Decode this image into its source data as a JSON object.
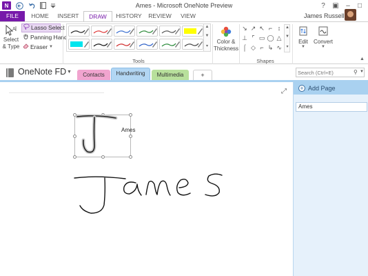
{
  "window": {
    "title": "Ames - Microsoft OneNote Preview",
    "app_icon_letter": "N",
    "qat_icons": [
      "back-icon",
      "undo-icon",
      "dock-to-desktop-icon",
      "customize-qat-icon"
    ],
    "controls": {
      "help": "?",
      "restore_ribbon": "▣",
      "minimize": "–",
      "maximize": "□"
    }
  },
  "ribbon_tabs": {
    "file": "FILE",
    "home": "HOME",
    "insert": "INSERT",
    "draw": "DRAW",
    "history": "HISTORY",
    "review": "REVIEW",
    "view": "VIEW",
    "active": "DRAW"
  },
  "account": {
    "user_name": "James Russell"
  },
  "ribbon": {
    "select_type": "Select\n& Type",
    "lasso_select": "Lasso Select",
    "panning_hand": "Panning Hand",
    "eraser": "Eraser",
    "tools_group": "Tools",
    "color_thickness": "Color &\nThickness",
    "shapes_group": "Shapes",
    "edit": "Edit",
    "convert": "Convert",
    "pens": [
      {
        "color": "#222222",
        "type": "pen"
      },
      {
        "color": "#e03a3a",
        "type": "pen"
      },
      {
        "color": "#3a6fd0",
        "type": "pen"
      },
      {
        "color": "#2e8b3a",
        "type": "pen"
      },
      {
        "color": "#555555",
        "type": "pen"
      },
      {
        "color": "#ffff00",
        "type": "highlighter"
      },
      {
        "color": "#00e5ee",
        "type": "highlighter"
      },
      {
        "color": "#111111",
        "type": "pen"
      },
      {
        "color": "#d02a2a",
        "type": "pen"
      },
      {
        "color": "#2b5fc8",
        "type": "pen"
      },
      {
        "color": "#2a8a3a",
        "type": "pen"
      },
      {
        "color": "#444444",
        "type": "pen"
      }
    ],
    "shapes": [
      "↘",
      "↗",
      "↖",
      "⌐",
      "↕",
      "⊥",
      "⌜",
      "▭",
      "◯",
      "△",
      "⌠",
      "◇",
      "⌐",
      "↳",
      "∿"
    ]
  },
  "notebook": {
    "name": "OneNote FD",
    "sections": [
      {
        "label": "Contacts",
        "color": "#f1a4cf"
      },
      {
        "label": "Handwriting",
        "color": "#b2d6f3"
      },
      {
        "label": "Multimedia",
        "color": "#b8e09c"
      }
    ],
    "add_section_label": "+",
    "active_section": "Handwriting"
  },
  "search": {
    "placeholder": "Search (Ctrl+E)"
  },
  "page": {
    "title_value": "",
    "ink_recognition": "Ames",
    "handwritten_word": "James"
  },
  "page_pane": {
    "add_page": "Add Page",
    "pages": [
      "Ames"
    ]
  },
  "colors": {
    "accent_purple": "#7719aa",
    "section_blue": "#a9d1f0",
    "pane_bg": "#e6f1fb"
  }
}
